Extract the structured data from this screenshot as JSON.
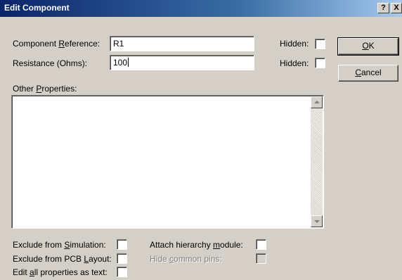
{
  "window": {
    "title": "Edit Component",
    "help_label": "?",
    "close_label": "X"
  },
  "fields": {
    "ref_label_a": "Component ",
    "ref_label_u": "R",
    "ref_label_b": "eference:",
    "ref_value": "R1",
    "res_label": "Resistance (Ohms):",
    "res_value": "100",
    "hidden_label": "Hidden:",
    "other_label_a": "Other ",
    "other_label_u": "P",
    "other_label_b": "roperties:",
    "other_value": ""
  },
  "checks": {
    "excl_sim_a": "Exclude from ",
    "excl_sim_u": "S",
    "excl_sim_b": "imulation:",
    "excl_pcb_a": "Exclude from PCB ",
    "excl_pcb_u": "L",
    "excl_pcb_b": "ayout:",
    "edit_all_a": "Edit ",
    "edit_all_u": "a",
    "edit_all_b": "ll properties as text:",
    "attach_a": "Attach hierarchy ",
    "attach_u": "m",
    "attach_b": "odule:",
    "hide_pins_a": "Hide ",
    "hide_pins_u": "c",
    "hide_pins_b": "ommon pins:"
  },
  "buttons": {
    "ok_u": "O",
    "ok_b": "K",
    "cancel_u": "C",
    "cancel_b": "ancel"
  }
}
